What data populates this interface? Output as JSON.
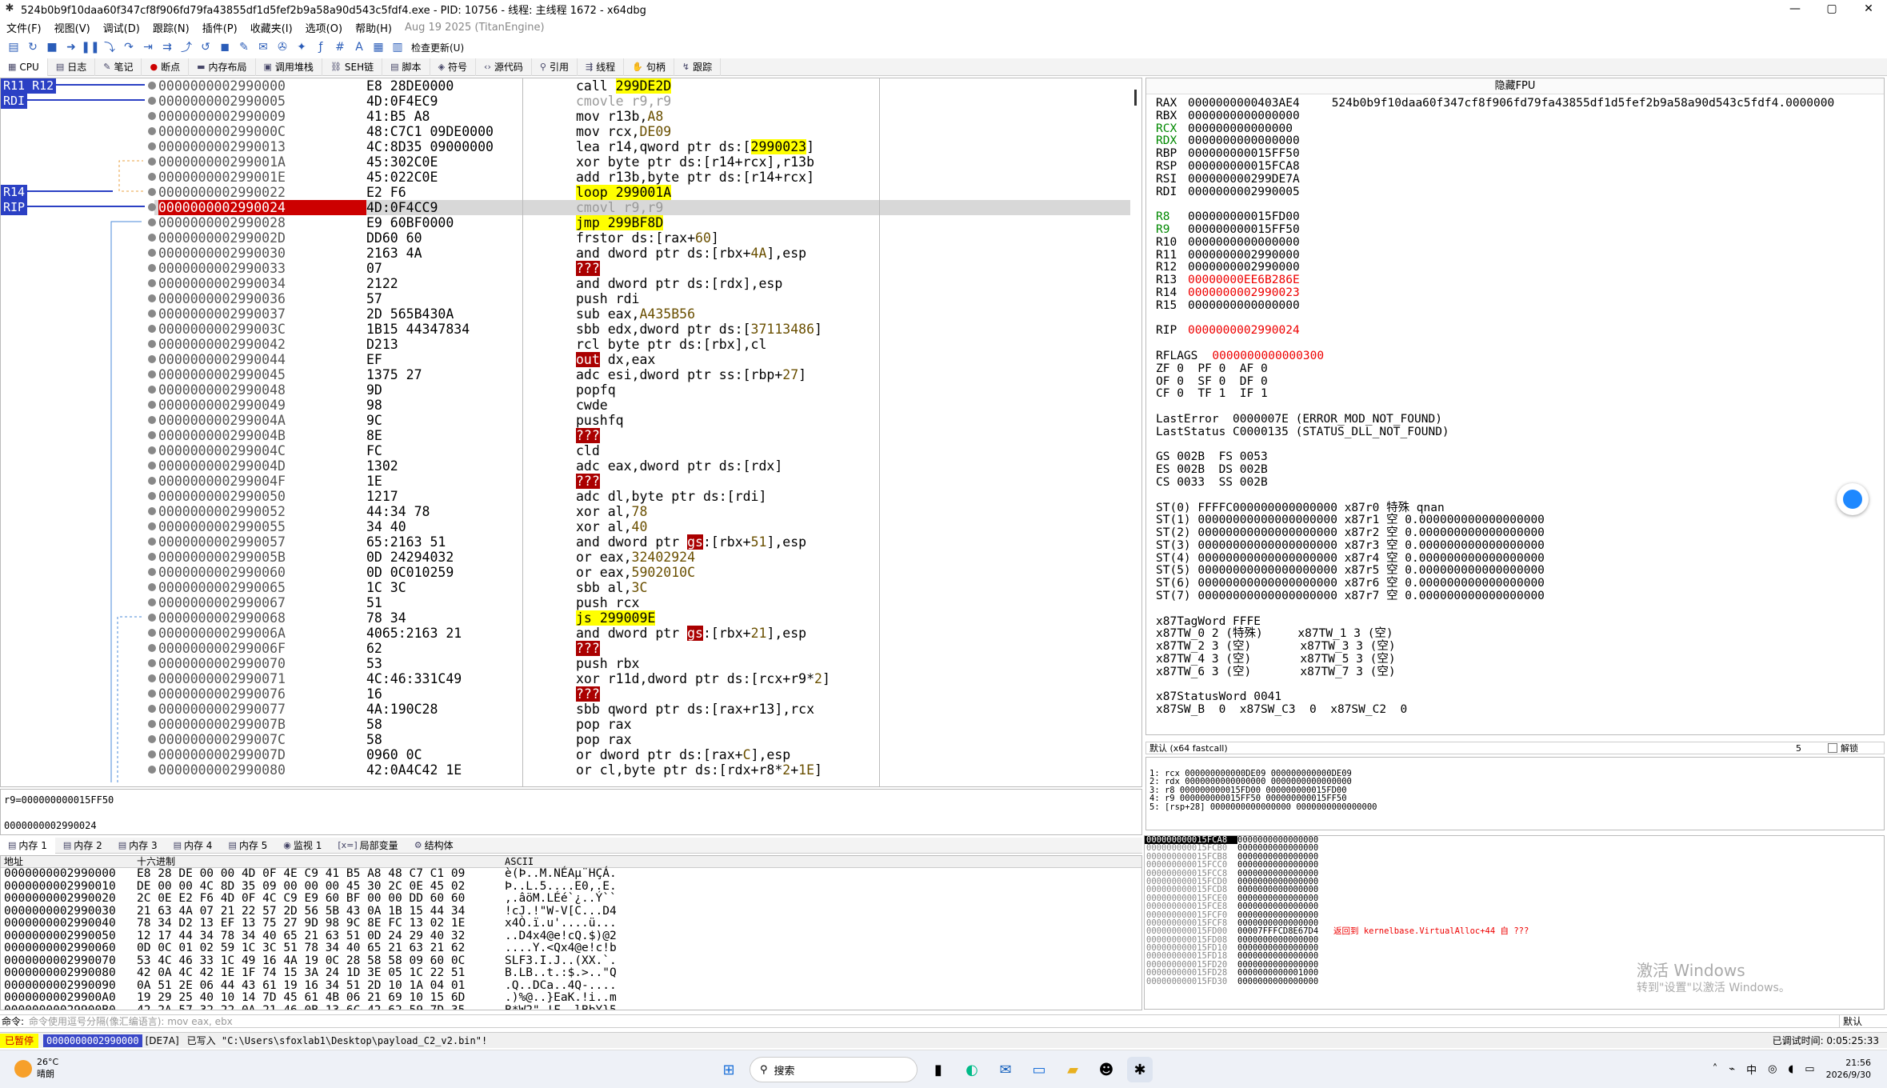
{
  "window": {
    "title": "524b0b9f10daa60f347cf8f906fd79fa43855df1d5fef2b9a58a90d543c5fdf4.exe - PID: 10756 - 线程: 主线程 1672 - x64dbg",
    "icon": "bug-icon",
    "min": "—",
    "max": "▢",
    "close": "✕"
  },
  "menu": {
    "items": [
      "文件(F)",
      "视图(V)",
      "调试(D)",
      "跟踪(N)",
      "插件(P)",
      "收藏夹(I)",
      "选项(O)",
      "帮助(H)"
    ],
    "build": "Aug 19 2025 (TitanEngine)"
  },
  "toolbar": {
    "check_update": "检查更新(U)"
  },
  "tabs": [
    "CPU",
    "日志",
    "笔记",
    "断点",
    "内存布局",
    "调用堆栈",
    "SEH链",
    "脚本",
    "符号",
    "源代码",
    "引用",
    "线程",
    "句柄",
    "跟踪"
  ],
  "gutter_labels": [
    {
      "text": "R11 R12",
      "row": 0
    },
    {
      "text": "RDI",
      "row": 1
    },
    {
      "text": "R14",
      "row": 7
    },
    {
      "text": "RIP",
      "row": 8
    }
  ],
  "disasm": [
    {
      "addr": "0000000002990000",
      "bytes": "E8 28DE0000",
      "ins": [
        [
          "call ",
          "mn"
        ],
        [
          "299DE2D",
          "hl-y"
        ]
      ]
    },
    {
      "addr": "0000000002990005",
      "bytes": "4D:0F4EC9",
      "ins": [
        [
          "cmovle r9,r9",
          "gray"
        ]
      ]
    },
    {
      "addr": "0000000002990009",
      "bytes": "41:B5 A8",
      "ins": [
        [
          "mov r13b,",
          "mn"
        ],
        [
          "A8",
          "num"
        ]
      ]
    },
    {
      "addr": "000000000299000C",
      "bytes": "48:C7C1 09DE0000",
      "ins": [
        [
          "mov rcx,",
          "mn"
        ],
        [
          "DE09",
          "num"
        ]
      ]
    },
    {
      "addr": "0000000002990013",
      "bytes": "4C:8D35 09000000",
      "ins": [
        [
          "lea r14,qword ptr ds:[",
          "mn"
        ],
        [
          "2990023",
          "hl-y"
        ],
        [
          "]",
          "mn"
        ]
      ]
    },
    {
      "addr": "000000000299001A",
      "bytes": "45:302C0E",
      "ins": [
        [
          "xor byte ptr ds:[r14+rcx],r13b",
          "mn"
        ]
      ]
    },
    {
      "addr": "000000000299001E",
      "bytes": "45:022C0E",
      "ins": [
        [
          "add r13b,byte ptr ds:[r14+rcx]",
          "mn"
        ]
      ]
    },
    {
      "addr": "0000000002990022",
      "bytes": "E2 F6",
      "ins": [
        [
          "loop ",
          "hl-y"
        ],
        [
          "299001A",
          "hl-y"
        ]
      ]
    },
    {
      "addr": "0000000002990024",
      "bytes": "4D:0F4CC9",
      "ins": [
        [
          "cmovl r9,r9",
          "gray"
        ]
      ],
      "cur": true
    },
    {
      "addr": "0000000002990028",
      "bytes": "E9 60BF0000",
      "ins": [
        [
          "jmp ",
          "hl-y"
        ],
        [
          "299BF8D",
          "hl-y"
        ]
      ]
    },
    {
      "addr": "000000000299002D",
      "bytes": "DD60 60",
      "ins": [
        [
          "frstor ds:[rax+",
          "mn"
        ],
        [
          "60",
          "num"
        ],
        [
          "]",
          "mn"
        ]
      ]
    },
    {
      "addr": "0000000002990030",
      "bytes": "2163 4A",
      "ins": [
        [
          "and dword ptr ds:[rbx+",
          "mn"
        ],
        [
          "4A",
          "num"
        ],
        [
          "],esp",
          "mn"
        ]
      ]
    },
    {
      "addr": "0000000002990033",
      "bytes": "07",
      "ins": [
        [
          "???",
          "hl-r"
        ]
      ]
    },
    {
      "addr": "0000000002990034",
      "bytes": "2122",
      "ins": [
        [
          "and dword ptr ds:[rdx],esp",
          "mn"
        ]
      ]
    },
    {
      "addr": "0000000002990036",
      "bytes": "57",
      "ins": [
        [
          "push rdi",
          "mn"
        ]
      ]
    },
    {
      "addr": "0000000002990037",
      "bytes": "2D 565B430A",
      "ins": [
        [
          "sub eax,",
          "mn"
        ],
        [
          "A435B56",
          "num"
        ]
      ]
    },
    {
      "addr": "000000000299003C",
      "bytes": "1B15 44347834",
      "ins": [
        [
          "sbb edx,dword ptr ds:[",
          "mn"
        ],
        [
          "37113486",
          "num"
        ],
        [
          "]",
          "mn"
        ]
      ]
    },
    {
      "addr": "0000000002990042",
      "bytes": "D213",
      "ins": [
        [
          "rcl byte ptr ds:[rbx],cl",
          "mn"
        ]
      ]
    },
    {
      "addr": "0000000002990044",
      "bytes": "EF",
      "ins": [
        [
          "out",
          "hl-r"
        ],
        [
          " dx,eax",
          "mn"
        ]
      ]
    },
    {
      "addr": "0000000002990045",
      "bytes": "1375 27",
      "ins": [
        [
          "adc esi,dword ptr ss:[rbp+",
          "mn"
        ],
        [
          "27",
          "num"
        ],
        [
          "]",
          "mn"
        ]
      ]
    },
    {
      "addr": "0000000002990048",
      "bytes": "9D",
      "ins": [
        [
          "popfq",
          "mn"
        ]
      ]
    },
    {
      "addr": "0000000002990049",
      "bytes": "98",
      "ins": [
        [
          "cwde",
          "mn"
        ]
      ]
    },
    {
      "addr": "000000000299004A",
      "bytes": "9C",
      "ins": [
        [
          "pushfq",
          "mn"
        ]
      ]
    },
    {
      "addr": "000000000299004B",
      "bytes": "8E",
      "ins": [
        [
          "???",
          "hl-r"
        ]
      ]
    },
    {
      "addr": "000000000299004C",
      "bytes": "FC",
      "ins": [
        [
          "cld",
          "mn"
        ]
      ]
    },
    {
      "addr": "000000000299004D",
      "bytes": "1302",
      "ins": [
        [
          "adc eax,dword ptr ds:[rdx]",
          "mn"
        ]
      ]
    },
    {
      "addr": "000000000299004F",
      "bytes": "1E",
      "ins": [
        [
          "???",
          "hl-r"
        ]
      ]
    },
    {
      "addr": "0000000002990050",
      "bytes": "1217",
      "ins": [
        [
          "adc dl,byte ptr ds:[rdi]",
          "mn"
        ]
      ]
    },
    {
      "addr": "0000000002990052",
      "bytes": "44:34 78",
      "ins": [
        [
          "xor al,",
          "mn"
        ],
        [
          "78",
          "num"
        ]
      ]
    },
    {
      "addr": "0000000002990055",
      "bytes": "34 40",
      "ins": [
        [
          "xor al,",
          "mn"
        ],
        [
          "40",
          "num"
        ]
      ]
    },
    {
      "addr": "0000000002990057",
      "bytes": "65:2163 51",
      "ins": [
        [
          "and dword ptr ",
          "mn"
        ],
        [
          "gs",
          "hl-r"
        ],
        [
          ":[rbx+",
          "mn"
        ],
        [
          "51",
          "num"
        ],
        [
          "],esp",
          "mn"
        ]
      ]
    },
    {
      "addr": "000000000299005B",
      "bytes": "0D 24294032",
      "ins": [
        [
          "or eax,",
          "mn"
        ],
        [
          "32402924",
          "num"
        ]
      ]
    },
    {
      "addr": "0000000002990060",
      "bytes": "0D 0C010259",
      "ins": [
        [
          "or eax,",
          "mn"
        ],
        [
          "5902010C",
          "num"
        ]
      ]
    },
    {
      "addr": "0000000002990065",
      "bytes": "1C 3C",
      "ins": [
        [
          "sbb al,",
          "mn"
        ],
        [
          "3C",
          "num"
        ]
      ]
    },
    {
      "addr": "0000000002990067",
      "bytes": "51",
      "ins": [
        [
          "push rcx",
          "mn"
        ]
      ]
    },
    {
      "addr": "0000000002990068",
      "bytes": "78 34",
      "ins": [
        [
          "js ",
          "hl-y"
        ],
        [
          "299009E",
          "hl-y"
        ]
      ]
    },
    {
      "addr": "000000000299006A",
      "bytes": "4065:2163 21",
      "ins": [
        [
          "and dword ptr ",
          "mn"
        ],
        [
          "gs",
          "hl-r"
        ],
        [
          ":[rbx+",
          "mn"
        ],
        [
          "21",
          "num"
        ],
        [
          "],esp",
          "mn"
        ]
      ]
    },
    {
      "addr": "000000000299006F",
      "bytes": "62",
      "ins": [
        [
          "???",
          "hl-r"
        ]
      ]
    },
    {
      "addr": "0000000002990070",
      "bytes": "53",
      "ins": [
        [
          "push rbx",
          "mn"
        ]
      ]
    },
    {
      "addr": "0000000002990071",
      "bytes": "4C:46:331C49",
      "ins": [
        [
          "xor r11d,dword ptr ds:[rcx+r9*",
          "mn"
        ],
        [
          "2",
          "num"
        ],
        [
          "]",
          "mn"
        ]
      ]
    },
    {
      "addr": "0000000002990076",
      "bytes": "16",
      "ins": [
        [
          "???",
          "hl-r"
        ]
      ]
    },
    {
      "addr": "0000000002990077",
      "bytes": "4A:190C28",
      "ins": [
        [
          "sbb qword ptr ds:[rax+r13],rcx",
          "mn"
        ]
      ]
    },
    {
      "addr": "000000000299007B",
      "bytes": "58",
      "ins": [
        [
          "pop rax",
          "mn"
        ]
      ]
    },
    {
      "addr": "000000000299007C",
      "bytes": "58",
      "ins": [
        [
          "pop rax",
          "mn"
        ]
      ]
    },
    {
      "addr": "000000000299007D",
      "bytes": "0960 0C",
      "ins": [
        [
          "or dword ptr ds:[rax+",
          "mn"
        ],
        [
          "C",
          "num"
        ],
        [
          "],esp",
          "mn"
        ]
      ]
    },
    {
      "addr": "0000000002990080",
      "bytes": "42:0A4C42 1E",
      "ins": [
        [
          "or cl,byte ptr ds:[rdx+r8*",
          "mn"
        ],
        [
          "2",
          "num"
        ],
        [
          "+",
          "mn"
        ],
        [
          "1E",
          "num"
        ],
        [
          "]",
          "mn"
        ]
      ]
    }
  ],
  "disasm_status": {
    "line1": "r9=000000000015FF50",
    "line2": "0000000002990024"
  },
  "regs": {
    "header": "隐藏FPU",
    "gp": [
      [
        "RAX",
        "0000000000403AE4",
        "",
        "524b0b9f10daa60f347cf8f906fd79fa43855df1d5fef2b9a58a90d543c5fdf4.0000000"
      ],
      [
        "RBX",
        "0000000000000000",
        ""
      ],
      [
        "RCX",
        "000000000000000",
        "green"
      ],
      [
        "RDX",
        "0000000000000000",
        "green"
      ],
      [
        "RBP",
        "000000000015FF50",
        ""
      ],
      [
        "RSP",
        "000000000015FCA8",
        ""
      ],
      [
        "RSI",
        "000000000299DE7A",
        ""
      ],
      [
        "RDI",
        "0000000002990005",
        ""
      ]
    ],
    "ext": [
      [
        "R8",
        "000000000015FD00",
        "green"
      ],
      [
        "R9",
        "000000000015FF50",
        "green"
      ],
      [
        "R10",
        "0000000000000000",
        ""
      ],
      [
        "R11",
        "0000000002990000",
        ""
      ],
      [
        "R12",
        "0000000002990000",
        ""
      ],
      [
        "R13",
        "00000000EE6B286E",
        "red"
      ],
      [
        "R14",
        "0000000002990023",
        "red"
      ],
      [
        "R15",
        "0000000000000000",
        ""
      ]
    ],
    "rip": [
      "RIP",
      "0000000002990024"
    ],
    "rflags": [
      "RFLAGS",
      "0000000000000300"
    ],
    "flags": [
      "ZF 0  PF 0  AF 0",
      "OF 0  SF 0  DF 0",
      "CF 0  TF 1  IF 1"
    ],
    "lasterror": "LastError  0000007E (ERROR_MOD_NOT_FOUND)",
    "laststatus": "LastStatus C0000135 (STATUS_DLL_NOT_FOUND)",
    "segs": [
      "GS 002B  FS 0053",
      "ES 002B  DS 002B",
      "CS 0033  SS 002B"
    ],
    "st": [
      "ST(0) FFFFC000000000000000 x87r0 特殊 qnan",
      "ST(1) 00000000000000000000 x87r1 空 0.000000000000000000",
      "ST(2) 00000000000000000000 x87r2 空 0.000000000000000000",
      "ST(3) 00000000000000000000 x87r3 空 0.000000000000000000",
      "ST(4) 00000000000000000000 x87r4 空 0.000000000000000000",
      "ST(5) 00000000000000000000 x87r5 空 0.000000000000000000",
      "ST(6) 00000000000000000000 x87r6 空 0.000000000000000000",
      "ST(7) 00000000000000000000 x87r7 空 0.000000000000000000"
    ],
    "tag": [
      "x87TagWord FFFE",
      "x87TW_0 2 (特殊)     x87TW_1 3 (空)",
      "x87TW_2 3 (空)       x87TW_3 3 (空)",
      "x87TW_4 3 (空)       x87TW_5 3 (空)",
      "x87TW_6 3 (空)       x87TW_7 3 (空)"
    ],
    "status": [
      "x87StatusWord 0041",
      "x87SW_B  0  x87SW_C3  0  x87SW_C2  0"
    ]
  },
  "callconv": {
    "label": "默认 (x64 fastcall)",
    "count": "5",
    "unlock": "解锁"
  },
  "args": [
    "1: rcx 000000000000DE09 000000000000DE09",
    "2: rdx 0000000000000000 0000000000000000",
    "3: r8 000000000015FD00 000000000015FD00",
    "4: r9 000000000015FF50 000000000015FF50",
    "5: [rsp+28] 0000000000000000 0000000000000000"
  ],
  "dumptabs": [
    "内存 1",
    "内存 2",
    "内存 3",
    "内存 4",
    "内存 5",
    "监视 1",
    "局部变量",
    "结构体"
  ],
  "dump": {
    "h_addr": "地址",
    "h_hex": "十六进制",
    "h_ascii": "ASCII",
    "rows": [
      [
        "0000000002990000",
        "E8 28 DE 00 00 4D 0F 4E C9 41 B5 A8 48 C7 C1 09",
        "è(Þ..M.NÉAµ¨HÇÁ."
      ],
      [
        "0000000002990010",
        "DE 00 00 4C 8D 35 09 00 00 00 45 30 2C 0E 45 02",
        "Þ..L.5....E0,.E."
      ],
      [
        "0000000002990020",
        "2C 0E E2 F6 4D 0F 4C C9 E9 60 BF 00 00 DD 60 60",
        ",.âöM.LÉé`¿..Ý``"
      ],
      [
        "0000000002990030",
        "21 63 4A 07 21 22 57 2D 56 5B 43 0A 1B 15 44 34",
        "!cJ.!\"W-V[C...D4"
      ],
      [
        "0000000002990040",
        "78 34 D2 13 EF 13 75 27 9D 98 9C 8E FC 13 02 1E",
        "x4Ò.ï.u'....ü..."
      ],
      [
        "0000000002990050",
        "12 17 44 34 78 34 40 65 21 63 51 0D 24 29 40 32",
        "..D4x4@e!cQ.$)@2"
      ],
      [
        "0000000002990060",
        "0D 0C 01 02 59 1C 3C 51 78 34 40 65 21 63 21 62",
        "....Y.<Qx4@e!c!b"
      ],
      [
        "0000000002990070",
        "53 4C 46 33 1C 49 16 4A 19 0C 28 58 58 09 60 0C",
        "SLF3.I.J..(XX.`."
      ],
      [
        "0000000002990080",
        "42 0A 4C 42 1E 1F 74 15 3A 24 1D 3E 05 1C 22 51",
        "B.LB..t.:$.>..\"Q"
      ],
      [
        "0000000002990090",
        "0A 51 2E 06 44 43 61 19 16 34 51 2D 10 1A 04 01",
        ".Q..DCa..4Q-...."
      ],
      [
        "00000000029900A0",
        "19 29 25 40 10 14 7D 45 61 4B 06 21 69 10 15 6D",
        ".)%@..}EaK.!i..m"
      ],
      [
        "00000000029900B0",
        "42 2A 57 32 22 0A 21 46 0B 13 6C 42 62 59 7D 35",
        "B*W2\".!F..lBbY}5"
      ]
    ]
  },
  "stack": {
    "rows": [
      [
        "000000000015FCA8",
        "0000000000000000",
        ""
      ],
      [
        "000000000015FCB0",
        "0000000000000000",
        ""
      ],
      [
        "000000000015FCB8",
        "0000000000000000",
        ""
      ],
      [
        "000000000015FCC0",
        "0000000000000000",
        ""
      ],
      [
        "000000000015FCC8",
        "0000000000000000",
        ""
      ],
      [
        "000000000015FCD0",
        "0000000000000000",
        ""
      ],
      [
        "000000000015FCD8",
        "0000000000000000",
        ""
      ],
      [
        "000000000015FCE0",
        "0000000000000000",
        ""
      ],
      [
        "000000000015FCE8",
        "0000000000000000",
        ""
      ],
      [
        "000000000015FCF0",
        "0000000000000000",
        ""
      ],
      [
        "000000000015FCF8",
        "0000000000000000",
        ""
      ],
      [
        "000000000015FD00",
        "00007FFFCD8E67D4",
        "返回到 kernelbase.VirtualAlloc+44 自 ???"
      ],
      [
        "000000000015FD08",
        "0000000000000000",
        ""
      ],
      [
        "000000000015FD10",
        "0000000000000000",
        ""
      ],
      [
        "000000000015FD18",
        "0000000000000000",
        ""
      ],
      [
        "000000000015FD20",
        "0000000000000000",
        ""
      ],
      [
        "000000000015FD28",
        "0000000000001000",
        ""
      ],
      [
        "000000000015FD30",
        "0000000000000000",
        ""
      ]
    ]
  },
  "watermark": {
    "title": "激活 Windows",
    "sub": "转到\"设置\"以激活 Windows。"
  },
  "cmd": {
    "label": "命令:",
    "placeholder": "命令使用逗号分隔(像汇编语言): mov eax, ebx",
    "default": "默认"
  },
  "status": {
    "paused": "已暂停",
    "addr": "0000000002990000",
    "tag": "[DE7A]",
    "msg": "已写入  \"C:\\Users\\sfoxlab1\\Desktop\\payload_C2_v2.bin\"!",
    "time": "已调试时间:  0:05:25:33"
  },
  "taskbar": {
    "temp": "26°C",
    "weather": "晴朗",
    "search": "搜索",
    "time": "21:56",
    "date": "2026/9/30",
    "ime": "中"
  }
}
